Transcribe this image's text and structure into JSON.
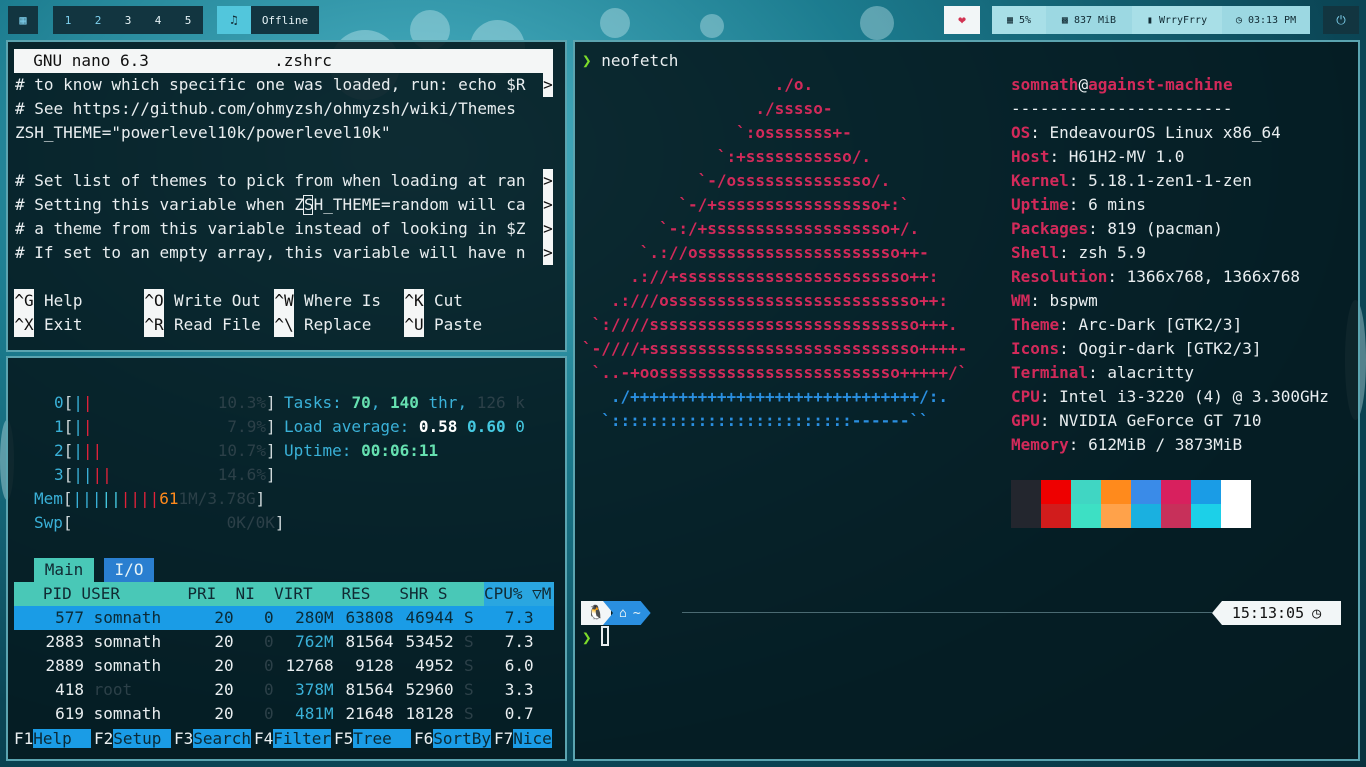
{
  "topbar": {
    "menu_icon": "grid-icon",
    "workspaces": [
      "1",
      "2",
      "3",
      "4",
      "5"
    ],
    "music_icon": "music-note-icon",
    "status": "Offline",
    "heart_icon": "heart-icon",
    "cpu": "5%",
    "memory": "837 MiB",
    "user": "WrryFrry",
    "time": "03:13 PM",
    "power_icon": "power-icon",
    "colors": {
      "bar_dark": "#123540",
      "accent": "#52c6dc",
      "status_light": "#a8dfe7"
    }
  },
  "nano": {
    "header": "  GNU nano 6.3             .zshrc",
    "lines": [
      "# to know which specific one was loaded, run: echo $R",
      "# See https://github.com/ohmyzsh/ohmyzsh/wiki/Themes",
      "ZSH_THEME=\"powerlevel10k/powerlevel10k\"",
      "",
      "# Set list of themes to pick from when loading at ran",
      "# Setting this variable when ZSH_THEME=random will ca",
      "# a theme from this variable instead of looking in $Z",
      "# If set to an empty array, this variable will have n"
    ],
    "shortcuts": [
      {
        "key": "^G",
        "label": "Help"
      },
      {
        "key": "^O",
        "label": "Write Out"
      },
      {
        "key": "^W",
        "label": "Where Is"
      },
      {
        "key": "^K",
        "label": "Cut"
      },
      {
        "key": "^X",
        "label": "Exit"
      },
      {
        "key": "^R",
        "label": "Read File"
      },
      {
        "key": "^\\",
        "label": "Replace"
      },
      {
        "key": "^U",
        "label": "Paste"
      }
    ]
  },
  "htop": {
    "cpus": [
      {
        "id": "0",
        "pct": "10.3%"
      },
      {
        "id": "1",
        "pct": "7.9%"
      },
      {
        "id": "2",
        "pct": "10.7%"
      },
      {
        "id": "3",
        "pct": "14.6%"
      }
    ],
    "mem": {
      "label": "Mem",
      "value": "61",
      "rest": "1M/3.78G"
    },
    "swp": {
      "label": "Swp",
      "value": "0K/0K"
    },
    "tasks_label": "Tasks:",
    "tasks": "70",
    "threads": "140",
    "thr_label": "thr",
    "running": "126 k",
    "load_label": "Load average:",
    "load1": "0.58",
    "load5": "0.60",
    "load15": "0",
    "uptime_label": "Uptime:",
    "uptime": "00:06:11",
    "tabs": [
      "Main",
      "I/O"
    ],
    "header": "   PID USER       PRI  NI  VIRT   RES   SHR S ",
    "header_cpu": "CPU% ▽M",
    "processes": [
      {
        "pid": "577",
        "user": "somnath",
        "pri": "20",
        "ni": "0",
        "virt": "280M",
        "res": "63808",
        "shr": "46944",
        "s": "S",
        "cpu": "7.3"
      },
      {
        "pid": "2883",
        "user": "somnath",
        "pri": "20",
        "ni": "0",
        "virt": "762M",
        "res": "81564",
        "shr": "53452",
        "s": "S",
        "cpu": "7.3"
      },
      {
        "pid": "2889",
        "user": "somnath",
        "pri": "20",
        "ni": "0",
        "virt": "12768",
        "res": "9128",
        "shr": "4952",
        "s": "S",
        "cpu": "6.0"
      },
      {
        "pid": "418",
        "user": "root",
        "pri": "20",
        "ni": "0",
        "virt": "378M",
        "res": "81564",
        "shr": "52960",
        "s": "S",
        "cpu": "3.3"
      },
      {
        "pid": "619",
        "user": "somnath",
        "pri": "20",
        "ni": "0",
        "virt": "481M",
        "res": "21648",
        "shr": "18128",
        "s": "S",
        "cpu": "0.7"
      }
    ],
    "fkeys": [
      {
        "num": "F1",
        "label": "Help  "
      },
      {
        "num": "F2",
        "label": "Setup "
      },
      {
        "num": "F3",
        "label": "Search"
      },
      {
        "num": "F4",
        "label": "Filter"
      },
      {
        "num": "F5",
        "label": "Tree  "
      },
      {
        "num": "F6",
        "label": "SortBy"
      },
      {
        "num": "F7",
        "label": "Nice"
      }
    ]
  },
  "neofetch": {
    "prompt_symbol": "❯",
    "command": "neofetch",
    "user": "somnath",
    "at": "@",
    "host": "against-machine",
    "separator": "-----------------------",
    "info": [
      {
        "key": "OS",
        "value": "EndeavourOS Linux x86_64"
      },
      {
        "key": "Host",
        "value": "H61H2-MV 1.0"
      },
      {
        "key": "Kernel",
        "value": "5.18.1-zen1-1-zen"
      },
      {
        "key": "Uptime",
        "value": "6 mins"
      },
      {
        "key": "Packages",
        "value": "819 (pacman)"
      },
      {
        "key": "Shell",
        "value": "zsh 5.9"
      },
      {
        "key": "Resolution",
        "value": "1366x768, 1366x768"
      },
      {
        "key": "WM",
        "value": "bspwm"
      },
      {
        "key": "Theme",
        "value": "Arc-Dark [GTK2/3]"
      },
      {
        "key": "Icons",
        "value": "Qogir-dark [GTK2/3]"
      },
      {
        "key": "Terminal",
        "value": "alacritty"
      },
      {
        "key": "CPU",
        "value": "Intel i3-3220 (4) @ 3.300GHz"
      },
      {
        "key": "GPU",
        "value": "NVIDIA GeForce GT 710"
      },
      {
        "key": "Memory",
        "value": "612MiB / 3873MiB"
      }
    ],
    "palette_top": [
      "#23262e",
      "#ee0000",
      "#40d6c3",
      "#ff8a1c",
      "#3a8be8",
      "#d8205e",
      "#1a9ce6",
      "#ffffff"
    ],
    "palette_bottom": [
      "#23262e",
      "#d11c1c",
      "#3de0c4",
      "#ffa24a",
      "#1ab0e0",
      "#c7305a",
      "#1cd0e8",
      "#ffffff"
    ],
    "art": [
      {
        "c": "red",
        "t": "                    ./o."
      },
      {
        "c": "red",
        "t": "                  ./sssso-"
      },
      {
        "c": "red",
        "t": "                `:osssssss+-"
      },
      {
        "c": "red",
        "t": "              `:+sssssssssso/."
      },
      {
        "c": "red",
        "t": "            `-/ossssssssssssso/."
      },
      {
        "c": "red",
        "t": "          `-/+sssssssssssssssso+:`"
      },
      {
        "c": "red",
        "t": "        `-:/+sssssssssssssssssso+/."
      },
      {
        "c": "red",
        "t": "      `.://osssssssssssssssssssso++-"
      },
      {
        "c": "red",
        "t": "     .://+ssssssssssssssssssssssso++:"
      },
      {
        "c": "red",
        "t": "   .:///ossssssssssssssssssssssssso++:"
      },
      {
        "c": "red",
        "t": " `:////ssssssssssssssssssssssssssso+++."
      },
      {
        "c": "red",
        "t": "`-////+ssssssssssssssssssssssssssso++++-"
      },
      {
        "c": "red",
        "t": " `..-+oosssssssssssssssssssssssso+++++/`"
      },
      {
        "c": "blue",
        "t": "   ./++++++++++++++++++++++++++++++/:."
      },
      {
        "c": "blue",
        "t": "  `:::::::::::::::::::::::::------``"
      }
    ]
  },
  "prompt": {
    "tux_icon": "linux-tux-icon",
    "home_icon": "home-icon",
    "dir": "~",
    "time": "15:13:05",
    "clock_icon": "clock-icon",
    "arrow": "❯"
  }
}
